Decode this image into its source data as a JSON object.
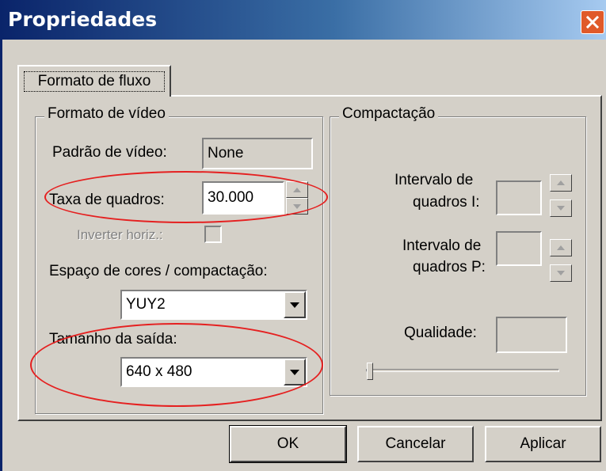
{
  "window": {
    "title": "Propriedades"
  },
  "tabs": [
    {
      "label": "Formato de fluxo"
    }
  ],
  "video_format": {
    "legend": "Formato de vídeo",
    "standard_label": "Padrão de vídeo:",
    "standard_value": "None",
    "frame_rate_label": "Taxa de quadros:",
    "frame_rate_value": "30.000",
    "flip_label": "Inverter horiz.:",
    "color_space_label": "Espaço de cores / compactação:",
    "color_space_value": "YUY2",
    "output_size_label": "Tamanho da saída:",
    "output_size_value": "640 x 480"
  },
  "compression": {
    "legend": "Compactação",
    "iframe_label_1": "Intervalo de",
    "iframe_label_2": "quadros I:",
    "pframe_label_1": "Intervalo de",
    "pframe_label_2": "quadros P:",
    "quality_label": "Qualidade:",
    "quality_slider_level": 0
  },
  "buttons": {
    "ok": "OK",
    "cancel": "Cancelar",
    "apply": "Aplicar"
  },
  "annotation_color": "#e52020",
  "icons": [
    "close-icon",
    "spin-up-arrow-icon",
    "spin-down-arrow-icon",
    "dropdown-arrow-icon"
  ]
}
